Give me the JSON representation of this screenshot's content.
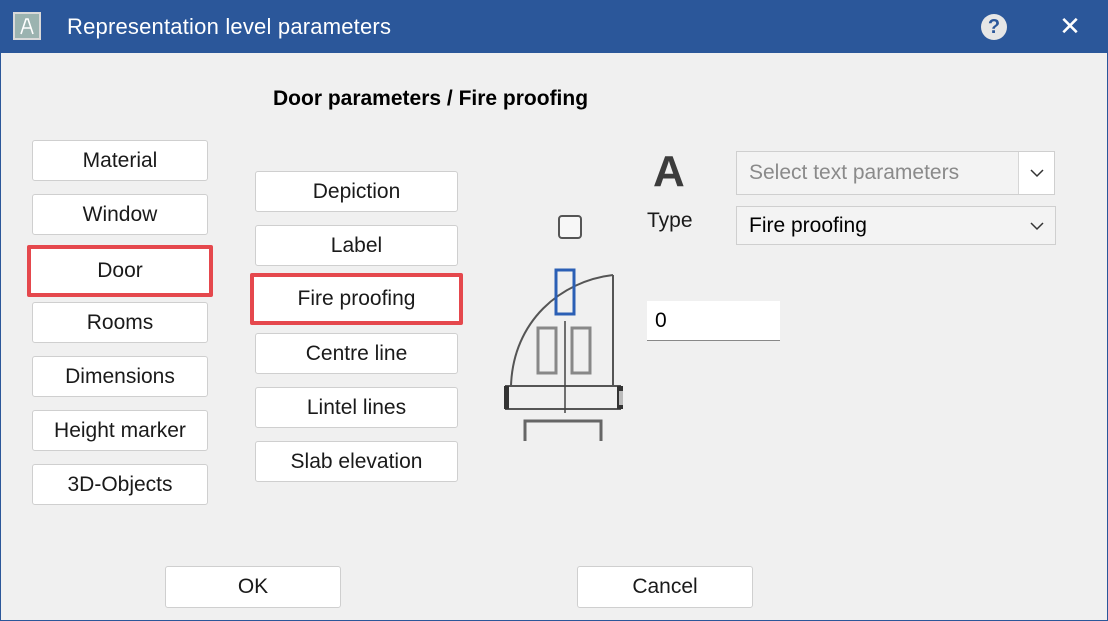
{
  "window": {
    "title": "Representation level parameters",
    "help_icon": "help-icon",
    "help_glyph": "?",
    "close_icon": "close-icon",
    "close_glyph": "✕",
    "accent": "#2b579a"
  },
  "heading": "Door parameters / Fire proofing",
  "categories": [
    {
      "label": "Material",
      "selected": false
    },
    {
      "label": "Window",
      "selected": false
    },
    {
      "label": "Door",
      "selected": true
    },
    {
      "label": "Rooms",
      "selected": false
    },
    {
      "label": "Dimensions",
      "selected": false
    },
    {
      "label": "Height marker",
      "selected": false
    },
    {
      "label": "3D-Objects",
      "selected": false
    }
  ],
  "subcategories": [
    {
      "label": "Depiction",
      "selected": false
    },
    {
      "label": "Label",
      "selected": false
    },
    {
      "label": "Fire proofing",
      "selected": true
    },
    {
      "label": "Centre line",
      "selected": false
    },
    {
      "label": "Lintel lines",
      "selected": false
    },
    {
      "label": "Slab elevation",
      "selected": false
    }
  ],
  "selection_color": "#e5484d",
  "text_params": {
    "glyph": "A",
    "placeholder": "Select text parameters"
  },
  "type": {
    "label": "Type",
    "value": "Fire proofing"
  },
  "checkbox_checked": false,
  "number_value": "0",
  "buttons": {
    "ok": "OK",
    "cancel": "Cancel"
  }
}
